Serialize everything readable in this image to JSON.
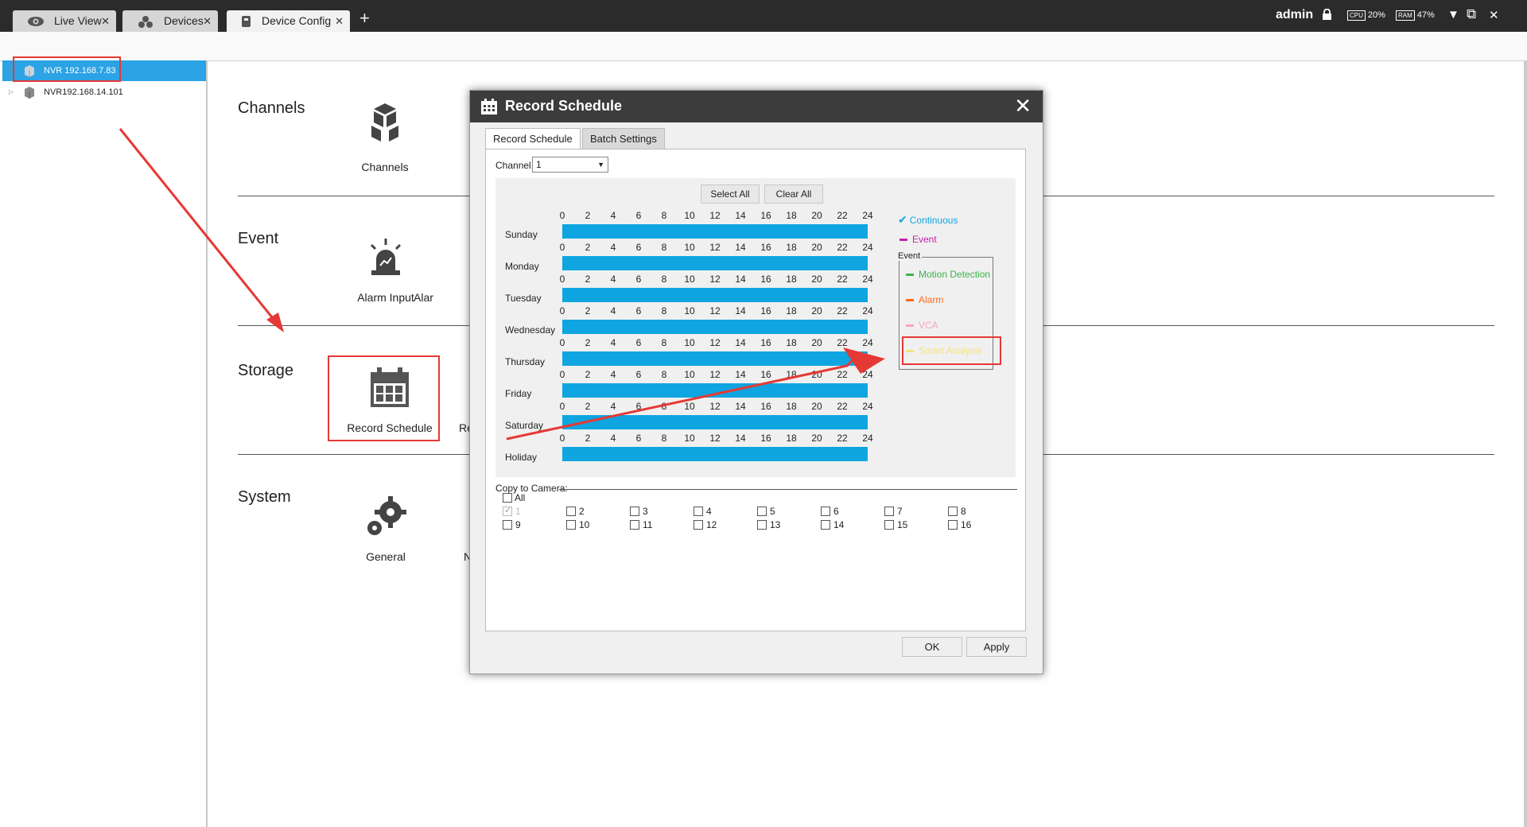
{
  "tabs": [
    {
      "label": "Live View",
      "icon": "eye-icon"
    },
    {
      "label": "Devices",
      "icon": "devices-icon"
    },
    {
      "label": "Device Config",
      "icon": "device-config-icon"
    }
  ],
  "header": {
    "user": "admin",
    "cpu_label": "CPU",
    "cpu_value": "20%",
    "ram_label": "RAM",
    "ram_value": "47%",
    "minimize": "▼",
    "restore": "⧉",
    "close": "✕"
  },
  "devices": [
    {
      "label": "NVR 192.168.7.83",
      "selected": true
    },
    {
      "label": "NVR192.168.14.101",
      "selected": false
    }
  ],
  "sections": {
    "channels": {
      "title": "Channels",
      "items": [
        "Channels"
      ]
    },
    "event": {
      "title": "Event",
      "items": [
        "Alarm Input",
        "Alar"
      ]
    },
    "storage": {
      "title": "Storage",
      "items": [
        "Record Schedule",
        "Re"
      ]
    },
    "system": {
      "title": "System",
      "items": [
        "General",
        "N"
      ]
    }
  },
  "modal": {
    "title": "Record Schedule",
    "tabs": [
      "Record Schedule",
      "Batch Settings"
    ],
    "channel_label": "Channel:",
    "channel_value": "1",
    "select_all": "Select All",
    "clear_all": "Clear All",
    "days": [
      "Sunday",
      "Monday",
      "Tuesday",
      "Wednesday",
      "Thursday",
      "Friday",
      "Saturday",
      "Holiday"
    ],
    "ticks": [
      "0",
      "2",
      "4",
      "6",
      "8",
      "10",
      "12",
      "14",
      "16",
      "18",
      "20",
      "22",
      "24"
    ],
    "legend": {
      "continuous": "Continuous",
      "event": "Event",
      "event_group_label": "Event",
      "motion": "Motion Detection",
      "alarm": "Alarm",
      "vca": "VCA",
      "smart": "Smart Analysis"
    },
    "colors": {
      "continuous": "#0fa5e0",
      "event": "#c81fa8",
      "motion": "#3bb54a",
      "alarm": "#ff6a1f",
      "vca": "#f7a3c8",
      "smart": "#f5e27a"
    },
    "copy_label": "Copy to Camera:",
    "all_label": "All",
    "cameras": [
      "1",
      "2",
      "3",
      "4",
      "5",
      "6",
      "7",
      "8",
      "9",
      "10",
      "11",
      "12",
      "13",
      "14",
      "15",
      "16"
    ],
    "ok": "OK",
    "apply": "Apply"
  }
}
